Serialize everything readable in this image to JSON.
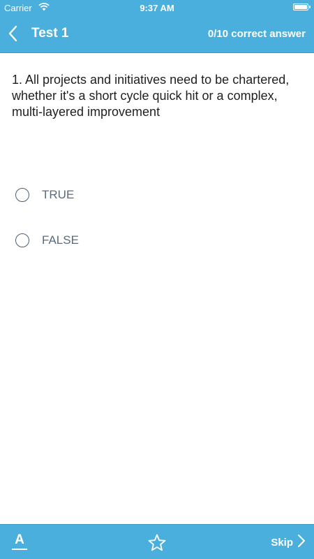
{
  "status_bar": {
    "carrier": "Carrier",
    "time": "9:37 AM",
    "wifi_icon": "wifi-icon",
    "battery_icon": "battery-icon"
  },
  "nav": {
    "back_icon": "chevron-left-icon",
    "title": "Test 1",
    "score": "0/10 correct answer"
  },
  "question": {
    "text": "1. All projects and initiatives need to be chartered, whether it's a short cycle quick hit or a complex, multi-layered improvement"
  },
  "options": [
    {
      "label": "TRUE",
      "selected": false
    },
    {
      "label": "FALSE",
      "selected": false
    }
  ],
  "toolbar": {
    "font_glyph": "A",
    "font_icon": "font-size-icon",
    "star_icon": "star-outline-icon",
    "skip_label": "Skip",
    "skip_icon": "chevron-right-icon"
  },
  "colors": {
    "accent": "#4aafdc",
    "text": "#1f1f1f",
    "option_text": "#5c6b7b",
    "radio_border": "#4b5f73"
  }
}
